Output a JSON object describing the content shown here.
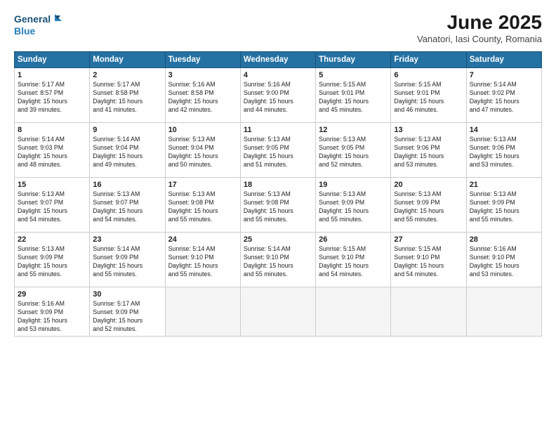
{
  "header": {
    "logo_line1": "General",
    "logo_line2": "Blue",
    "month_title": "June 2025",
    "subtitle": "Vanatori, Iasi County, Romania"
  },
  "days_of_week": [
    "Sunday",
    "Monday",
    "Tuesday",
    "Wednesday",
    "Thursday",
    "Friday",
    "Saturday"
  ],
  "weeks": [
    [
      {
        "day": "1",
        "text": "Sunrise: 5:17 AM\nSunset: 8:57 PM\nDaylight: 15 hours\nand 39 minutes."
      },
      {
        "day": "2",
        "text": "Sunrise: 5:17 AM\nSunset: 8:58 PM\nDaylight: 15 hours\nand 41 minutes."
      },
      {
        "day": "3",
        "text": "Sunrise: 5:16 AM\nSunset: 8:58 PM\nDaylight: 15 hours\nand 42 minutes."
      },
      {
        "day": "4",
        "text": "Sunrise: 5:16 AM\nSunset: 9:00 PM\nDaylight: 15 hours\nand 44 minutes."
      },
      {
        "day": "5",
        "text": "Sunrise: 5:15 AM\nSunset: 9:01 PM\nDaylight: 15 hours\nand 45 minutes."
      },
      {
        "day": "6",
        "text": "Sunrise: 5:15 AM\nSunset: 9:01 PM\nDaylight: 15 hours\nand 46 minutes."
      },
      {
        "day": "7",
        "text": "Sunrise: 5:14 AM\nSunset: 9:02 PM\nDaylight: 15 hours\nand 47 minutes."
      }
    ],
    [
      {
        "day": "8",
        "text": "Sunrise: 5:14 AM\nSunset: 9:03 PM\nDaylight: 15 hours\nand 48 minutes."
      },
      {
        "day": "9",
        "text": "Sunrise: 5:14 AM\nSunset: 9:04 PM\nDaylight: 15 hours\nand 49 minutes."
      },
      {
        "day": "10",
        "text": "Sunrise: 5:13 AM\nSunset: 9:04 PM\nDaylight: 15 hours\nand 50 minutes."
      },
      {
        "day": "11",
        "text": "Sunrise: 5:13 AM\nSunset: 9:05 PM\nDaylight: 15 hours\nand 51 minutes."
      },
      {
        "day": "12",
        "text": "Sunrise: 5:13 AM\nSunset: 9:05 PM\nDaylight: 15 hours\nand 52 minutes."
      },
      {
        "day": "13",
        "text": "Sunrise: 5:13 AM\nSunset: 9:06 PM\nDaylight: 15 hours\nand 53 minutes."
      },
      {
        "day": "14",
        "text": "Sunrise: 5:13 AM\nSunset: 9:06 PM\nDaylight: 15 hours\nand 53 minutes."
      }
    ],
    [
      {
        "day": "15",
        "text": "Sunrise: 5:13 AM\nSunset: 9:07 PM\nDaylight: 15 hours\nand 54 minutes."
      },
      {
        "day": "16",
        "text": "Sunrise: 5:13 AM\nSunset: 9:07 PM\nDaylight: 15 hours\nand 54 minutes."
      },
      {
        "day": "17",
        "text": "Sunrise: 5:13 AM\nSunset: 9:08 PM\nDaylight: 15 hours\nand 55 minutes."
      },
      {
        "day": "18",
        "text": "Sunrise: 5:13 AM\nSunset: 9:08 PM\nDaylight: 15 hours\nand 55 minutes."
      },
      {
        "day": "19",
        "text": "Sunrise: 5:13 AM\nSunset: 9:09 PM\nDaylight: 15 hours\nand 55 minutes."
      },
      {
        "day": "20",
        "text": "Sunrise: 5:13 AM\nSunset: 9:09 PM\nDaylight: 15 hours\nand 55 minutes."
      },
      {
        "day": "21",
        "text": "Sunrise: 5:13 AM\nSunset: 9:09 PM\nDaylight: 15 hours\nand 55 minutes."
      }
    ],
    [
      {
        "day": "22",
        "text": "Sunrise: 5:13 AM\nSunset: 9:09 PM\nDaylight: 15 hours\nand 55 minutes."
      },
      {
        "day": "23",
        "text": "Sunrise: 5:14 AM\nSunset: 9:09 PM\nDaylight: 15 hours\nand 55 minutes."
      },
      {
        "day": "24",
        "text": "Sunrise: 5:14 AM\nSunset: 9:10 PM\nDaylight: 15 hours\nand 55 minutes."
      },
      {
        "day": "25",
        "text": "Sunrise: 5:14 AM\nSunset: 9:10 PM\nDaylight: 15 hours\nand 55 minutes."
      },
      {
        "day": "26",
        "text": "Sunrise: 5:15 AM\nSunset: 9:10 PM\nDaylight: 15 hours\nand 54 minutes."
      },
      {
        "day": "27",
        "text": "Sunrise: 5:15 AM\nSunset: 9:10 PM\nDaylight: 15 hours\nand 54 minutes."
      },
      {
        "day": "28",
        "text": "Sunrise: 5:16 AM\nSunset: 9:10 PM\nDaylight: 15 hours\nand 53 minutes."
      }
    ],
    [
      {
        "day": "29",
        "text": "Sunrise: 5:16 AM\nSunset: 9:09 PM\nDaylight: 15 hours\nand 53 minutes."
      },
      {
        "day": "30",
        "text": "Sunrise: 5:17 AM\nSunset: 9:09 PM\nDaylight: 15 hours\nand 52 minutes."
      },
      {
        "day": "",
        "text": ""
      },
      {
        "day": "",
        "text": ""
      },
      {
        "day": "",
        "text": ""
      },
      {
        "day": "",
        "text": ""
      },
      {
        "day": "",
        "text": ""
      }
    ]
  ]
}
